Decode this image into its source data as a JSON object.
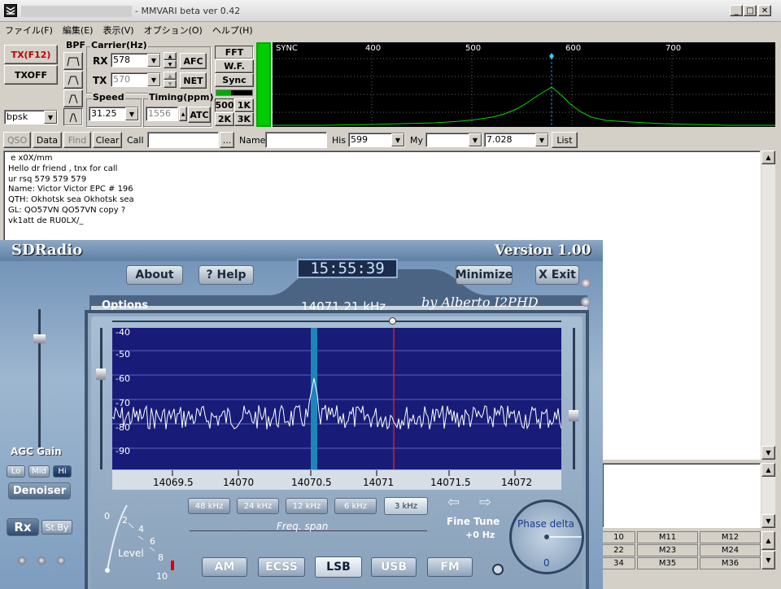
{
  "window": {
    "title": "- MMVARI beta ver 0.42"
  },
  "menu": [
    "ファイル(F)",
    "編集(E)",
    "表示(V)",
    "オプション(O)",
    "ヘルプ(H)"
  ],
  "left": {
    "tx": "TX(F12)",
    "txoff": "TXOFF",
    "mode": "bpsk"
  },
  "bpf": {
    "label": "BPF"
  },
  "carrier": {
    "label": "Carrier(Hz)",
    "rx_label": "RX",
    "rx": "578",
    "tx_label": "TX",
    "tx": "570",
    "afc": "AFC",
    "net": "NET"
  },
  "speed": {
    "label": "Speed",
    "value": "31.25"
  },
  "timing": {
    "label": "Timing(ppm)",
    "value": "1556",
    "atc": "ATC"
  },
  "view": {
    "fft": "FFT",
    "wf": "W.F.",
    "sync": "Sync",
    "b500": "500",
    "b1k": "1K",
    "b2k": "2K",
    "b3k": "3K"
  },
  "spectrum": {
    "sync": "SYNC",
    "ticks": [
      "400",
      "500",
      "600",
      "700"
    ]
  },
  "qsobar": {
    "qso": "QSO",
    "data": "Data",
    "find": "Find",
    "clear": "Clear",
    "call": "Call",
    "call_value": "",
    "dots": "...",
    "name": "Name",
    "name_value": "",
    "his": "His",
    "his_value": "599",
    "my": "My",
    "my_value": "",
    "freq": "7.028",
    "list": "List"
  },
  "rx_text": [
    " e x0X/mm",
    "Hello dr friend , tnx for call",
    "ur rsq 579 579 579",
    "Name: Victor Victor EPC # 196",
    "QTH: Okhotsk sea Okhotsk sea",
    "GL: QO57VN QO57VN copy ?",
    "vk1att de RU0LX/_"
  ],
  "memory": {
    "rows": [
      [
        "10",
        "M11",
        "M12"
      ],
      [
        "22",
        "M23",
        "M24"
      ],
      [
        "34",
        "M35",
        "M36"
      ]
    ]
  },
  "sdr": {
    "title": "SDRadio",
    "version": "Version 1.00",
    "about": "About",
    "help": "? Help",
    "clock": "15:55:39",
    "minimize": "Minimize",
    "exit": "X Exit",
    "options": "Options",
    "freq": "14071.21 kHz",
    "author": "by Alberto I2PHD",
    "db_labels": [
      "-40",
      "-50",
      "-60",
      "-70",
      "-80",
      "-90"
    ],
    "freq_labels": [
      "14069.5",
      "14070",
      "14070.5",
      "14071",
      "14071.5",
      "14072"
    ],
    "agc": "AGC Gain",
    "lo": "Lo",
    "mid": "Mid",
    "hi": "Hi",
    "denoiser": "Denoiser",
    "rx": "Rx",
    "stby": "St.By",
    "spans": [
      "48 kHz",
      "24 kHz",
      "12 kHz",
      "6 kHz",
      "3 kHz"
    ],
    "span_label": "Freq. span",
    "fine_tune": "Fine Tune",
    "fine_val": "+0 Hz",
    "phase": "Phase delta",
    "phase_val": "0",
    "level": "Level",
    "level_ticks": [
      "0",
      "2",
      "4",
      "6",
      "8",
      "10"
    ],
    "modes": [
      "AM",
      "ECSS",
      "LSB",
      "USB",
      "FM"
    ],
    "active_mode": "LSB"
  }
}
